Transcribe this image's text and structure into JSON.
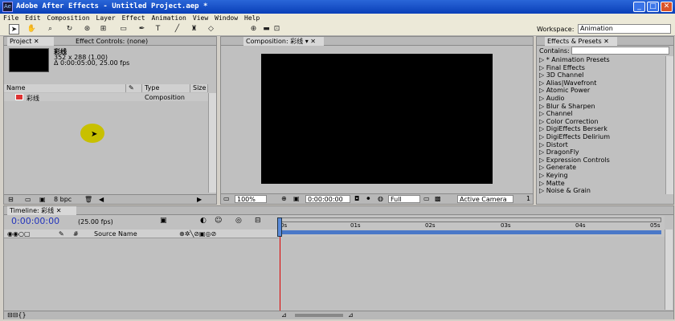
{
  "window": {
    "title": "Adobe After Effects - Untitled Project.aep *"
  },
  "menu": [
    "File",
    "Edit",
    "Composition",
    "Layer",
    "Effect",
    "Animation",
    "View",
    "Window",
    "Help"
  ],
  "workspace": {
    "label": "Workspace:",
    "value": "Animation"
  },
  "project": {
    "tab_label": "Project",
    "effect_controls_label": "Effect Controls: (none)",
    "comp_name": "彩线",
    "dims": "352 x 288 (1.00)",
    "duration": "Δ 0:00:05:00, 25.00 fps",
    "columns": {
      "name": "Name",
      "type": "Type",
      "size": "Size"
    },
    "items": [
      {
        "name": "彩线",
        "type": "Composition"
      }
    ],
    "bpc": "8 bpc"
  },
  "composition": {
    "tab_label": "Composition: 彩线",
    "zoom": "100%",
    "timecode": "0:00:00:00",
    "resolution": "Full",
    "camera": "Active Camera",
    "view_count": "1"
  },
  "effects": {
    "tab_label": "Effects & Presets",
    "contains_label": "Contains:",
    "items": [
      "* Animation Presets",
      "Final Effects",
      "3D Channel",
      "Alias|Wavefront",
      "Atomic Power",
      "Audio",
      "Blur & Sharpen",
      "Channel",
      "Color Correction",
      "DigiEffects Berserk",
      "DigiEffects Delirium",
      "Distort",
      "DragonFly",
      "Expression Controls",
      "Generate",
      "Keying",
      "Matte",
      "Noise & Grain"
    ]
  },
  "timeline": {
    "tab_label": "Timeline: 彩线",
    "timecode": "0:00:00:00",
    "fps": "(25.00 fps)",
    "source_name": "Source Name",
    "hash": "#",
    "ruler": [
      "0s",
      "01s",
      "02s",
      "03s",
      "04s",
      "05s"
    ]
  }
}
